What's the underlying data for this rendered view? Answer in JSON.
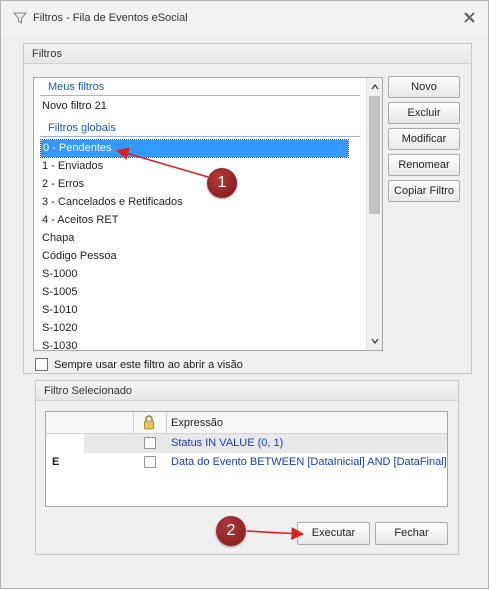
{
  "window": {
    "title": "Filtros - Fila de Eventos eSocial"
  },
  "filters_group": {
    "header": "Filtros",
    "my_filters_header": "Meus filtros",
    "my_filters": [
      "Novo filtro 21"
    ],
    "global_filters_header": "Filtros globais",
    "items": [
      "0 - Pendentes",
      "1 - Enviados",
      "2 - Erros",
      "3 - Cancelados e Retificados",
      "4 - Aceitos RET",
      "Chapa",
      "Código Pessoa",
      "S-1000",
      "S-1005",
      "S-1010",
      "S-1020",
      "S-1030"
    ],
    "selected_index": 0,
    "buttons": {
      "novo": "Novo",
      "excluir": "Excluir",
      "modificar": "Modificar",
      "renomear": "Renomear",
      "copiar": "Copiar Filtro"
    },
    "always_use_label": "Sempre usar este filtro ao abrir a visão"
  },
  "selected_group": {
    "header": "Filtro Selecionado",
    "column_expression": "Expressão",
    "rows": [
      {
        "marker": "",
        "expression": "Status IN VALUE (0, 1)"
      },
      {
        "marker": "E",
        "expression": "Data do Evento BETWEEN [DataInicial] AND [DataFinal]"
      }
    ],
    "execute_label": "Executar",
    "close_label": "Fechar"
  },
  "annotations": {
    "badge1": "1",
    "badge2": "2"
  },
  "colors": {
    "selection": "#3399ff",
    "header_text": "#1c5bb8",
    "expression_text": "#1a3dc0",
    "badge": "#8b1c1c",
    "arrow": "#e02020"
  }
}
